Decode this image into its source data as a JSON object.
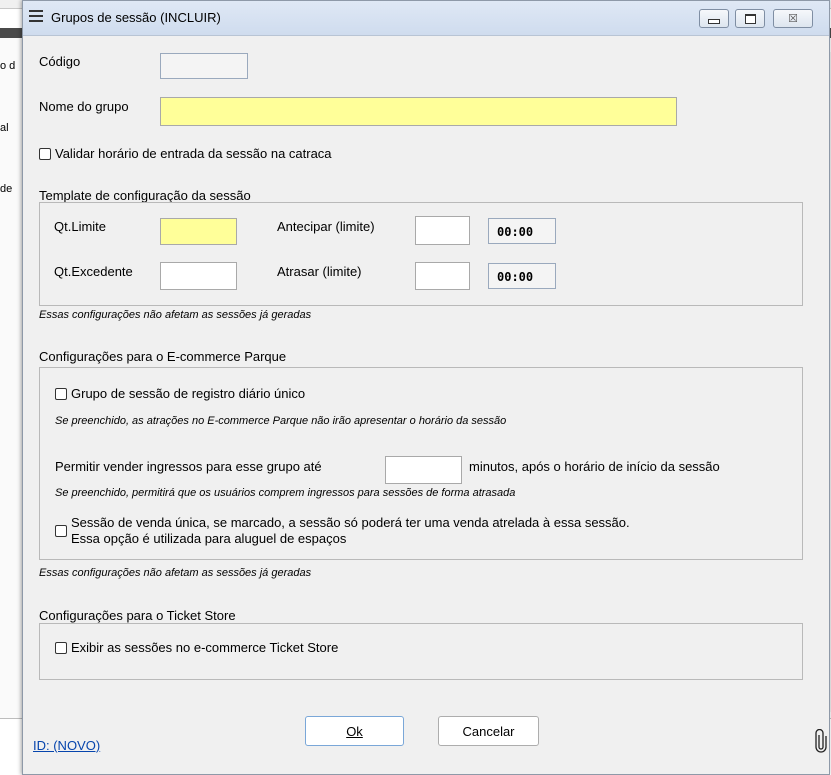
{
  "background": {
    "frag1": "o d",
    "frag2": "al",
    "frag3": "de"
  },
  "dialog": {
    "title": "Grupos de sessão (INCLUIR)",
    "titlebar_icons": [
      "menu-icon",
      "minimize-icon",
      "maximize-icon",
      "close-icon"
    ],
    "close_glyph": "☒"
  },
  "form": {
    "codigo_label": "Código",
    "codigo_value": "",
    "nome_label": "Nome do grupo",
    "nome_value": "",
    "validar_label": "Validar horário de entrada da sessão na catraca",
    "validar_checked": false
  },
  "template": {
    "title": "Template de configuração da sessão",
    "qtlimite_label": "Qt.Limite",
    "qtlimite_value": "",
    "qtexcedente_label": "Qt.Excedente",
    "qtexcedente_value": "",
    "antecipar_label": "Antecipar (limite)",
    "antecipar_value": "",
    "antecipar_time": "00:00",
    "atrasar_label": "Atrasar (limite)",
    "atrasar_value": "",
    "atrasar_time": "00:00",
    "note": "Essas configurações não afetam as sessões já geradas"
  },
  "ecommerce": {
    "title": "Configurações para o E-commerce Parque",
    "grupo_unico_label": "Grupo de sessão de registro diário único",
    "grupo_unico_checked": false,
    "grupo_unico_note": "Se preenchido, as atrações no E-commerce Parque não irão apresentar o horário da sessão",
    "permitir_label": "Permitir vender ingressos para esse grupo até",
    "permitir_value": "",
    "permitir_suffix": "minutos, após o horário de início da sessão",
    "permitir_note": "Se preenchido, permitirá que os usuários comprem ingressos para sessões de forma atrasada",
    "venda_unica_line1": "Sessão de venda única, se marcado, a sessão só poderá ter uma venda atrelada à essa sessão.",
    "venda_unica_line2": "Essa opção é utilizada para aluguel de espaços",
    "venda_unica_checked": false,
    "note": "Essas configurações não afetam as sessões já geradas"
  },
  "ticketstore": {
    "title": "Configurações para o Ticket Store",
    "exibir_label": "Exibir as sessões no e-commerce Ticket Store",
    "exibir_checked": false
  },
  "footer": {
    "id_link": "ID: (NOVO)",
    "ok_label": "Ok",
    "cancel_label": "Cancelar",
    "attachment_icon": "paperclip-icon"
  }
}
